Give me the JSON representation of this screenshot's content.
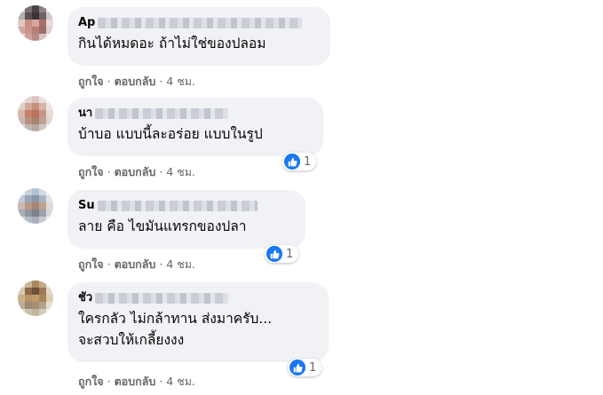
{
  "like_label": "ถูกใจ",
  "reply_label": "ตอบกลับ",
  "separator": "·",
  "like_color": "#1877f2",
  "comments": [
    {
      "author_visible": "Ap",
      "lines": [
        "กินได้หมดอะ ถ้าไม่ใช่ของปลอม"
      ],
      "time": "4 ชม.",
      "reactions": null
    },
    {
      "author_visible": "นา",
      "lines": [
        "บ้าบอ แบบนี้ละอร่อย แบบในรูป"
      ],
      "time": "4 ชม.",
      "reactions": "1"
    },
    {
      "author_visible": "Su",
      "lines": [
        "ลาย คือ ไขมันแทรกของปลา"
      ],
      "time": "4 ชม.",
      "reactions": "1"
    },
    {
      "author_visible": "ชัว",
      "lines": [
        "ใครกลัว ไม่กล้าทาน ส่งมาครับ...",
        "จะสวบให้เกลี้ยงงง"
      ],
      "time": "4 ชม.",
      "reactions": "1"
    }
  ]
}
